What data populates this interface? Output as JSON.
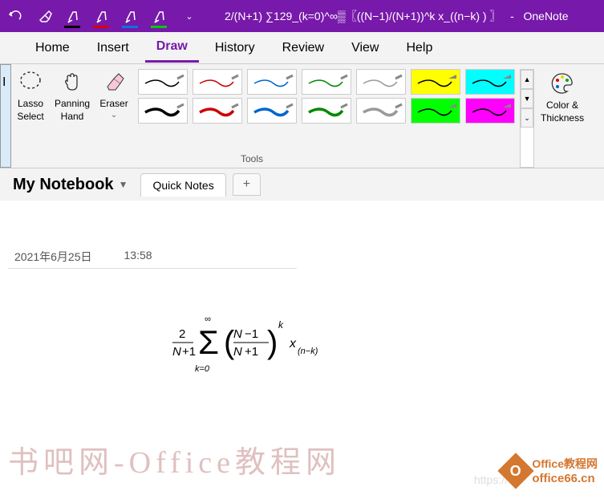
{
  "titlebar": {
    "formula_text": "2/(N+1) ∑129_(k=0)^∞▒〖((N−1)/(N+1))^k x_((n−k) ) 〗",
    "app_name": "OneNote",
    "icons": [
      "undo",
      "eraser",
      "highlighter-black",
      "highlighter-red",
      "highlighter-blue",
      "highlighter-green",
      "more"
    ]
  },
  "ribbon": {
    "tabs": [
      "Home",
      "Insert",
      "Draw",
      "History",
      "Review",
      "View",
      "Help"
    ],
    "active_tab": "Draw",
    "tools": {
      "lasso": "Lasso\nSelect",
      "panning": "Panning\nHand",
      "eraser": "Eraser",
      "color_thickness": "Color &\nThickness",
      "group_label": "Tools"
    }
  },
  "notebook": {
    "name": "My Notebook",
    "section": "Quick Notes"
  },
  "page": {
    "date": "2021年6月25日",
    "time": "13:58"
  },
  "watermark": {
    "text1": "书吧网-Office教程网",
    "url": "https://",
    "logo_top": "Office教程网",
    "logo_bottom": "office66.cn"
  }
}
